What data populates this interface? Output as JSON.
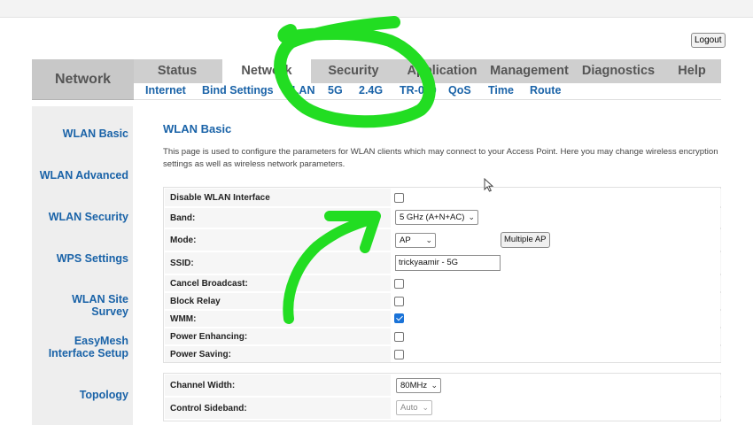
{
  "header": {
    "logout_label": "Logout",
    "brand": "Network"
  },
  "main_nav": [
    {
      "label": "Status"
    },
    {
      "label": "Network",
      "active": true
    },
    {
      "label": "Security"
    },
    {
      "label": "Application"
    },
    {
      "label": "Management"
    },
    {
      "label": "Diagnostics"
    },
    {
      "label": "Help"
    }
  ],
  "sub_nav": [
    {
      "label": "Internet"
    },
    {
      "label": "Bind Settings"
    },
    {
      "label": "WLAN"
    },
    {
      "label": "5G"
    },
    {
      "label": "2.4G"
    },
    {
      "label": "TR-069"
    },
    {
      "label": "QoS"
    },
    {
      "label": "Time"
    },
    {
      "label": "Route"
    }
  ],
  "sidebar": [
    {
      "label": "WLAN Basic"
    },
    {
      "label": "WLAN Advanced"
    },
    {
      "label": "WLAN Security"
    },
    {
      "label": "WPS Settings"
    },
    {
      "label": "WLAN Site Survey"
    },
    {
      "label": "EasyMesh Interface Setup"
    },
    {
      "label": "Topology"
    }
  ],
  "page": {
    "title": "WLAN Basic",
    "description": "This page is used to configure the parameters for WLAN clients which may connect to your Access Point. Here you may change wireless encryption settings as well as wireless network parameters."
  },
  "form": {
    "disable_wlan": {
      "label": "Disable WLAN Interface",
      "checked": false
    },
    "band": {
      "label": "Band:",
      "value": "5 GHz (A+N+AC)"
    },
    "mode": {
      "label": "Mode:",
      "value": "AP",
      "multiple_ap_label": "Multiple AP"
    },
    "ssid": {
      "label": "SSID:",
      "value": "trickyaamir - 5G"
    },
    "cancel_broadcast": {
      "label": "Cancel Broadcast:",
      "checked": false
    },
    "block_relay": {
      "label": "Block Relay",
      "checked": false
    },
    "wmm": {
      "label": "WMM:",
      "checked": true
    },
    "power_enhancing": {
      "label": "Power Enhancing:",
      "checked": false
    },
    "power_saving": {
      "label": "Power Saving:",
      "checked": false
    },
    "channel_width": {
      "label": "Channel Width:",
      "value": "80MHz"
    },
    "control_sideband": {
      "label": "Control Sideband:",
      "value": "Auto"
    }
  },
  "colors": {
    "link_blue": "#1a63a8",
    "nav_gray": "#cfcfcf",
    "sidebar_gray": "#eeeeee",
    "checkbox_blue": "#1a73d8",
    "annotation_green": "#22dd22"
  },
  "icons": [
    "caret-down-icon",
    "mouse-cursor-icon",
    "checkmark-icon"
  ]
}
